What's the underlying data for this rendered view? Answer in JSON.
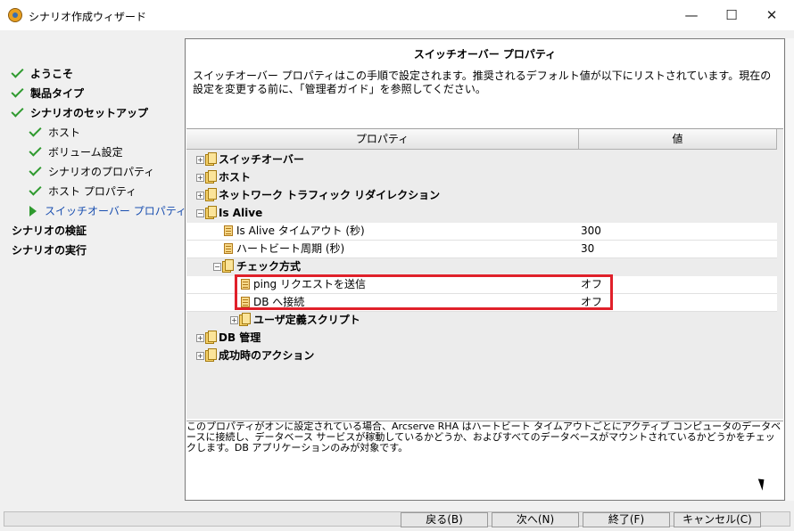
{
  "window": {
    "title": "シナリオ作成ウィザード",
    "minimize": "—",
    "maximize": "☐",
    "close": "✕"
  },
  "nav": {
    "items": [
      {
        "label": "ようこそ",
        "state": "done"
      },
      {
        "label": "製品タイプ",
        "state": "done"
      },
      {
        "label": "シナリオのセットアップ",
        "state": "done"
      },
      {
        "label": "ホスト",
        "state": "done"
      },
      {
        "label": "ボリューム設定",
        "state": "done"
      },
      {
        "label": "シナリオのプロパティ",
        "state": "done"
      },
      {
        "label": "ホスト プロパティ",
        "state": "done"
      },
      {
        "label": "スイッチオーバー プロパティ",
        "state": "current"
      },
      {
        "label": "シナリオの検証",
        "state": "pending"
      },
      {
        "label": "シナリオの実行",
        "state": "pending"
      }
    ]
  },
  "panel": {
    "title": "スイッチオーバー プロパティ",
    "description": "スイッチオーバー プロパティはこの手順で設定されます。推奨されるデフォルト値が以下にリストされています。現在の設定を変更する前に、「管理者ガイド」を参照してください。"
  },
  "table": {
    "headers": {
      "property": "プロパティ",
      "value": "値"
    },
    "rows": [
      {
        "label": "スイッチオーバー",
        "value": "",
        "expander": "+"
      },
      {
        "label": "ホスト",
        "value": "",
        "expander": "+"
      },
      {
        "label": "ネットワーク トラフィック リダイレクション",
        "value": "",
        "expander": "+"
      },
      {
        "label": "Is Alive",
        "value": "",
        "expander": "−"
      },
      {
        "label": "Is Alive タイムアウト (秒)",
        "value": "300",
        "expander": ""
      },
      {
        "label": "ハートビート周期 (秒)",
        "value": "30",
        "expander": ""
      },
      {
        "label": "チェック方式",
        "value": "",
        "expander": "−"
      },
      {
        "label": "ping リクエストを送信",
        "value": "オフ",
        "expander": ""
      },
      {
        "label": "DB へ接続",
        "value": "オフ",
        "expander": ""
      },
      {
        "label": "ユーザ定義スクリプト",
        "value": "",
        "expander": "+"
      },
      {
        "label": "DB 管理",
        "value": "",
        "expander": "+"
      },
      {
        "label": "成功時のアクション",
        "value": "",
        "expander": "+"
      }
    ]
  },
  "info": {
    "text": "このプロパティがオンに設定されている場合、Arcserve RHA はハートビート タイムアウトごとにアクティブ コンピュータのデータベースに接続し、データベース サービスが稼動しているかどうか、およびすべてのデータベースがマウントされているかどうかをチェックします。DB アプリケーションのみが対象です。"
  },
  "footer": {
    "back": "戻る(B)",
    "next": "次へ(N)",
    "finish": "終了(F)",
    "cancel": "キャンセル(C)"
  },
  "colors": {
    "accent_current": "#1a4fb0",
    "check_green": "#2f9a2f",
    "highlight_red": "#e0202a"
  }
}
